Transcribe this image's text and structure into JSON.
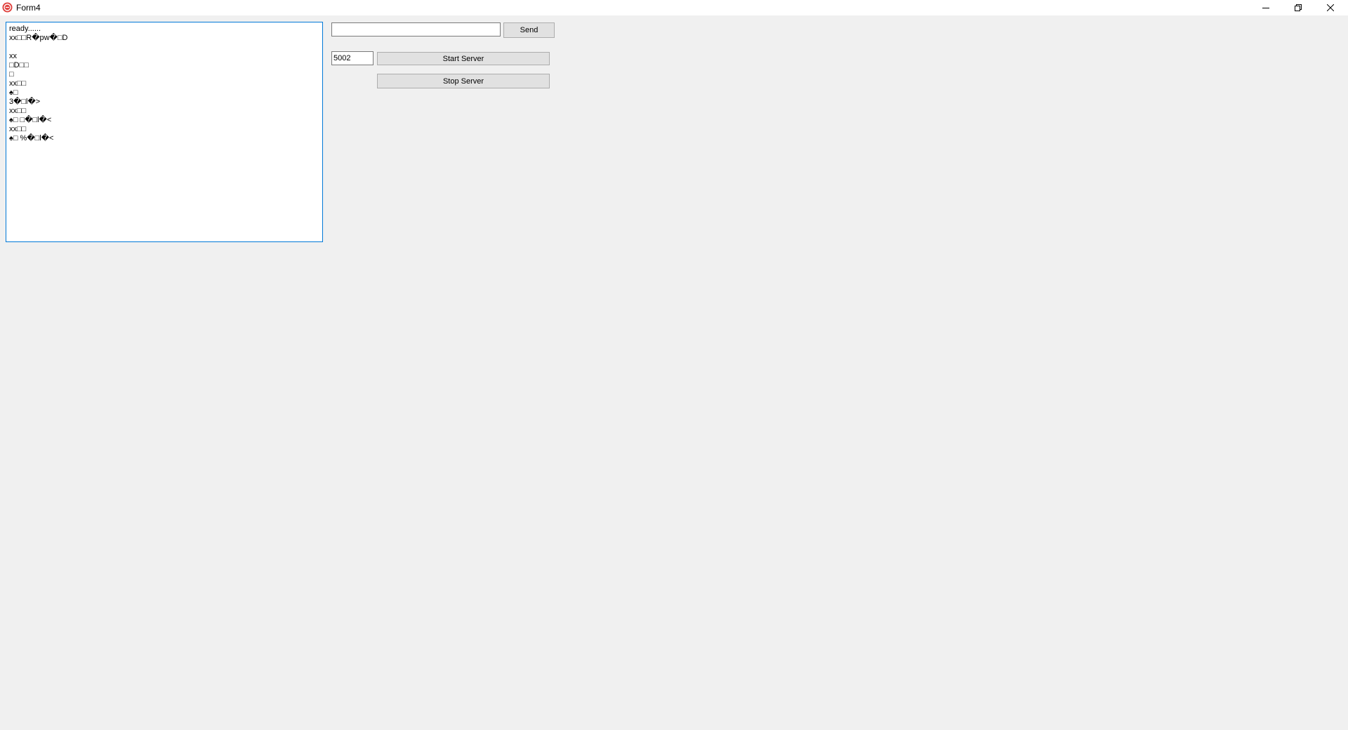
{
  "window": {
    "title": "Form4",
    "icon": "app-logo-icon",
    "controls": {
      "minimize": "minimize-icon",
      "restore": "restore-icon",
      "close": "close-icon"
    }
  },
  "log": {
    "lines": [
      "ready......",
      "xx□□R�pw�□D",
      "",
      "xx",
      "□D□□",
      "□",
      "xx□□",
      "♠□",
      "3�□l�>",
      "xx□□",
      "♠□ □�□l�<",
      "xx□□",
      "♠□ %�□l�<"
    ]
  },
  "message": {
    "value": "",
    "send_label": "Send"
  },
  "server": {
    "port": "5002",
    "start_label": "Start Server",
    "stop_label": "Stop Server"
  }
}
